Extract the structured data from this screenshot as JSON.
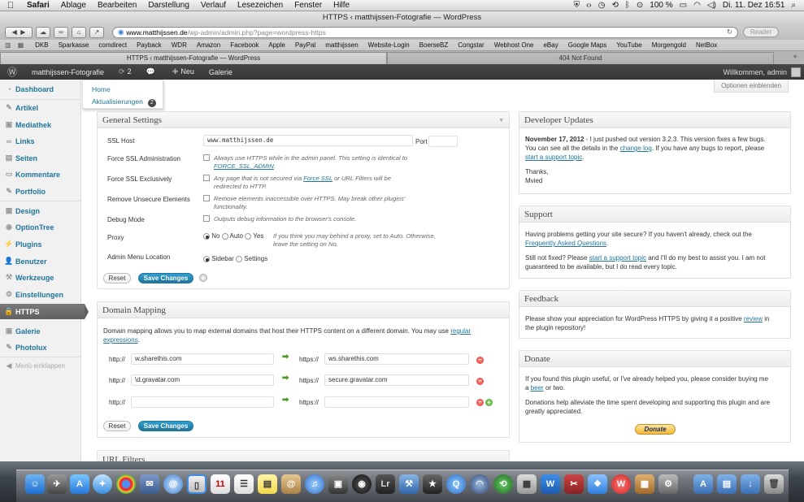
{
  "menubar": {
    "items": [
      "Safari",
      "Ablage",
      "Bearbeiten",
      "Darstellung",
      "Verlauf",
      "Lesezeichen",
      "Fenster",
      "Hilfe"
    ],
    "battery": "100 %",
    "clock": "Di. 11. Dez  16:51"
  },
  "window": {
    "title": "HTTPS ‹ matthijssen-Fotografie — WordPress",
    "url_host": "www.matthijssen.de",
    "url_path": "/wp-admin/admin.php?page=wordpress-https",
    "reader_label": "Reader"
  },
  "bookmarks": [
    "DKB",
    "Sparkasse",
    "comdirect",
    "Payback",
    "WDR",
    "Amazon",
    "Facebook",
    "Apple",
    "PayPal",
    "matthijssen",
    "Website-Login",
    "BoerseBZ",
    "Congstar",
    "Webhost One",
    "eBay",
    "Google Maps",
    "YouTube",
    "Morgengold",
    "NetBox"
  ],
  "tabs": [
    {
      "label": "HTTPS ‹ matthijssen-Fotografie — WordPress"
    },
    {
      "label": "404 Not Found"
    }
  ],
  "adminbar": {
    "site": "matthijssen-Fotografie",
    "updates": "2",
    "new_label": "Neu",
    "gallery_label": "Galerie",
    "greeting": "Willkommen, admin"
  },
  "sidebar": {
    "items": [
      "Dashboard",
      "Artikel",
      "Mediathek",
      "Links",
      "Seiten",
      "Kommentare",
      "Portfolio",
      "Design",
      "OptionTree",
      "Plugins",
      "Benutzer",
      "Werkzeuge",
      "Einstellungen",
      "HTTPS",
      "Galerie",
      "Photolux",
      "Menü einklappen"
    ]
  },
  "flyout": {
    "home": "Home",
    "updates": "Aktualisierungen",
    "updates_count": "2"
  },
  "screen_options": "Optionen einblenden",
  "general": {
    "title": "General Settings",
    "ssl_host_label": "SSL Host",
    "ssl_host_value": "www.matthijssen.de",
    "port_label": "Port",
    "force_admin_label": "Force SSL Administration",
    "force_admin_desc_1": "Always use HTTPS while in the admin panel. This setting is identical to",
    "force_admin_desc_link": "FORCE_SSL_ADMIN",
    "force_admin_desc_2": ".",
    "force_excl_label": "Force SSL Exclusively",
    "force_excl_desc_1": "Any page that is not secured via",
    "force_excl_desc_link": "Force SSL",
    "force_excl_desc_2": "or URL Filters will be",
    "force_excl_desc_3": "redirected to HTTP.",
    "remove_label": "Remove Unsecure Elements",
    "remove_desc_1": "Remove elements inaccessible over HTTPS. May break other plugins'",
    "remove_desc_2": "functionality.",
    "debug_label": "Debug Mode",
    "debug_desc": "Outputs debug information to the browser's console.",
    "proxy_label": "Proxy",
    "proxy_options": [
      "No",
      "Auto",
      "Yes"
    ],
    "proxy_desc_1": "If you think you may behind a proxy, set to Auto. Otherwise,",
    "proxy_desc_2": "leave the setting on No.",
    "menu_loc_label": "Admin Menu Location",
    "menu_loc_options": [
      "Sidebar",
      "Settings"
    ],
    "reset_label": "Reset",
    "save_label": "Save Changes"
  },
  "domain": {
    "title": "Domain Mapping",
    "intro_1": "Domain mapping allows you to map external domains that host their HTTPS content on a different domain. You may use",
    "intro_link_1": "regular",
    "intro_link_2": "expressions",
    "intro_2": ".",
    "http_label": "http://",
    "https_label": "https://",
    "rows": [
      {
        "http": "w.sharethis.com",
        "https": "ws.sharethis.com"
      },
      {
        "http": "\\d.gravatar.com",
        "https": "secure.gravatar.com"
      },
      {
        "http": "",
        "https": ""
      }
    ],
    "reset_label": "Reset",
    "save_label": "Save Changes"
  },
  "url_filters": {
    "title": "URL Filters"
  },
  "dev_updates": {
    "title": "Developer Updates",
    "date": "November 17, 2012",
    "line1": " - I just pushed out version 3.2.3. This version fixes a few bugs.",
    "line2a": "You can see all the details in the",
    "line2_link": "change log",
    "line2b": ". If you have any bugs to report, please",
    "line3_link": "start a support topic",
    "line3b": ".",
    "thanks": "Thanks,",
    "sig": "Mvied"
  },
  "support": {
    "title": "Support",
    "p1a": "Having problems getting your site secure? If you haven't already, check out the",
    "p1_link": "Frequently Asked Questions",
    "p1b": ".",
    "p2a": "Still not fixed? Please",
    "p2_link": "start a support topic",
    "p2b": "and I'll do my best to assist you. I am not",
    "p2c": "guaranteed to be available, but I do read every topic."
  },
  "feedback": {
    "title": "Feedback",
    "p1a": "Please show your appreciation for WordPress HTTPS by giving it a positive",
    "p1_link": "review",
    "p1b": "in",
    "p1c": "the plugin repository!"
  },
  "donate": {
    "title": "Donate",
    "p1a": "If you found this plugin useful, or I've already helped you, please consider buying me",
    "p1b": "a",
    "p1_link": "beer",
    "p1c": "or two.",
    "p2a": "Donations help alleviate the time spent developing and supporting this plugin and are",
    "p2b": "greatly appreciated.",
    "button": "Donate"
  },
  "colors": {
    "wp_link": "#21759b",
    "adminbar": "#464646",
    "primary_button": "#21759b",
    "paypal_yellow": "#f7b731"
  }
}
